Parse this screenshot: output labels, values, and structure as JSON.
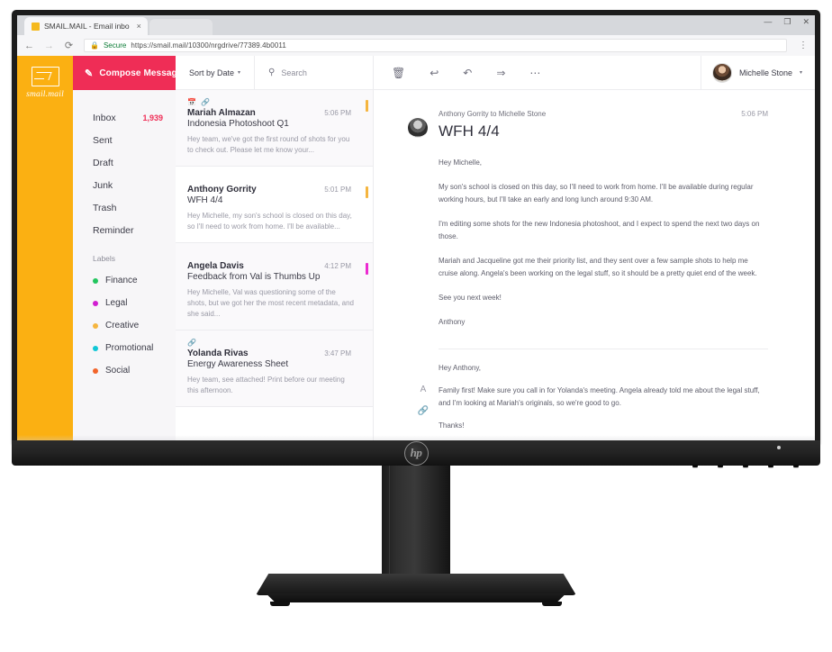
{
  "browser": {
    "tab": {
      "title": "SMAIL.MAIL - Email inbo",
      "close_label": "×",
      "favicon": "mail-favicon"
    },
    "window_controls": {
      "minimize": "—",
      "maximize": "❐",
      "close": "✕"
    },
    "nav": {
      "back": "←",
      "forward": "→",
      "reload": "⟳"
    },
    "omnibox": {
      "lock": "🔒",
      "security_label": "Secure",
      "url": "https://smail.mail/10300/nrgdrive/77389.4b0011"
    },
    "menu": "⋮"
  },
  "brand": {
    "name": "smail.mail",
    "icon": "envelope-icon"
  },
  "sidebar": {
    "compose": {
      "label": "Compose Message",
      "icon": "compose-icon"
    },
    "folders": [
      {
        "label": "Inbox",
        "count": "1,939"
      },
      {
        "label": "Sent",
        "count": ""
      },
      {
        "label": "Draft",
        "count": ""
      },
      {
        "label": "Junk",
        "count": ""
      },
      {
        "label": "Trash",
        "count": ""
      },
      {
        "label": "Reminder",
        "count": ""
      }
    ],
    "labels_heading": "Labels",
    "labels": [
      {
        "label": "Finance",
        "color": "#22c55e"
      },
      {
        "label": "Legal",
        "color": "#d11fd1"
      },
      {
        "label": "Creative",
        "color": "#f5b53f"
      },
      {
        "label": "Promotional",
        "color": "#11c7d6"
      },
      {
        "label": "Social",
        "color": "#f2642a"
      }
    ]
  },
  "list": {
    "sort": {
      "label": "Sort by Date",
      "caret": "▾"
    },
    "search": {
      "placeholder": "Search",
      "icon": "search-icon"
    },
    "messages": [
      {
        "from": "Mariah Almazan",
        "subject": "Indonesia Photoshoot Q1",
        "time": "5:06 PM",
        "preview": "Hey team, we've got the first round of shots for you to check out. Please let me know your...",
        "icons": [
          "calendar-icon",
          "attachment-icon"
        ],
        "flag_color": "#f5b53f",
        "read": true
      },
      {
        "from": "Anthony Gorrity",
        "subject": "WFH 4/4",
        "time": "5:01 PM",
        "preview": "Hey Michelle, my son's school is closed on this day, so I'll need to work from home. I'll be available...",
        "icons": [],
        "flag_color": "#f5b53f",
        "read": false
      },
      {
        "from": "Angela Davis",
        "subject": "Feedback from Val is Thumbs Up",
        "time": "4:12 PM",
        "preview": "Hey Michelle, Val was questioning some of the shots, but we got her the most recent metadata, and she said...",
        "icons": [],
        "flag_color": "#ec2bd1",
        "read": true
      },
      {
        "from": "Yolanda Rivas",
        "subject": "Energy Awareness Sheet",
        "time": "3:47 PM",
        "preview": "Hey team, see attached! Print before our meeting this afternoon.",
        "icons": [
          "attachment-icon"
        ],
        "flag_color": "",
        "read": true
      }
    ]
  },
  "reader": {
    "toolbar": [
      {
        "name": "delete-icon",
        "glyph": "🗑"
      },
      {
        "name": "reply-icon",
        "glyph": "↩"
      },
      {
        "name": "reply-all-icon",
        "glyph": "↶"
      },
      {
        "name": "forward-icon",
        "glyph": "↪"
      },
      {
        "name": "more-icon",
        "glyph": "•••"
      }
    ],
    "user": {
      "name": "Michelle Stone",
      "caret": "▾",
      "avatar": "user-avatar"
    },
    "meta_from": "Anthony Gorrity to Michelle Stone",
    "meta_time": "5:06 PM",
    "subject": "WFH 4/4",
    "paragraphs": [
      "Hey Michelle,",
      "My son's school is closed on this day, so I'll need to work from home. I'll be available during regular working hours, but I'll take an early and long lunch around 9:30 AM.",
      "I'm editing some shots for the new Indonesia photoshoot, and I expect to spend the next two days on those.",
      "Mariah and Jacqueline got me their priority list, and they sent over a few sample shots to help me cruise along. Angela's been working on the legal stuff, so it should be a pretty quiet end of the week.",
      "See you next week!",
      "Anthony"
    ],
    "reply": {
      "rail_icons": [
        {
          "name": "font-format-icon",
          "glyph": "A"
        },
        {
          "name": "attachment-icon",
          "glyph": "🔗"
        }
      ],
      "paragraphs": [
        "Hey Anthony,",
        "Family first! Make sure you call in for Yolanda's meeting. Angela already told me about the legal stuff, and I'm looking at Mariah's originals, so we're good to go.",
        "Thanks!"
      ]
    }
  },
  "hardware": {
    "brand_logo": "hp",
    "bezel_buttons": 5,
    "power_led": "power-led"
  }
}
